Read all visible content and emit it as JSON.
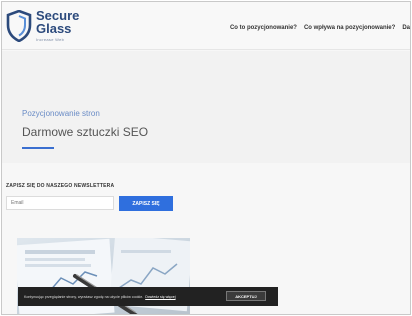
{
  "brand": {
    "line1": "Secure",
    "line2": "Glass",
    "tagline": "Increase Web"
  },
  "nav": {
    "items": [
      {
        "label": "Co to pozycjonowanie?"
      },
      {
        "label": "Co wpływa na pozycjonowanie?"
      },
      {
        "label": "Da"
      }
    ]
  },
  "hero": {
    "kicker": "Pozycjonowanie stron",
    "title": "Darmowe sztuczki SEO",
    "accent_color": "#3a6fd0"
  },
  "newsletter": {
    "heading": "ZAPISZ SIĘ DO NASZEGO NEWSLETTERA",
    "email_placeholder": "Email",
    "button_label": "ZAPISZ SIĘ",
    "button_color": "#2f6fde"
  },
  "cookie": {
    "text": "Kontynuując przeglądanie strony, wyrażasz zgodę na użycie plików cookie.",
    "link_label": "Dowiedz się więcej",
    "accept_label": "AKCEPTUJ"
  }
}
